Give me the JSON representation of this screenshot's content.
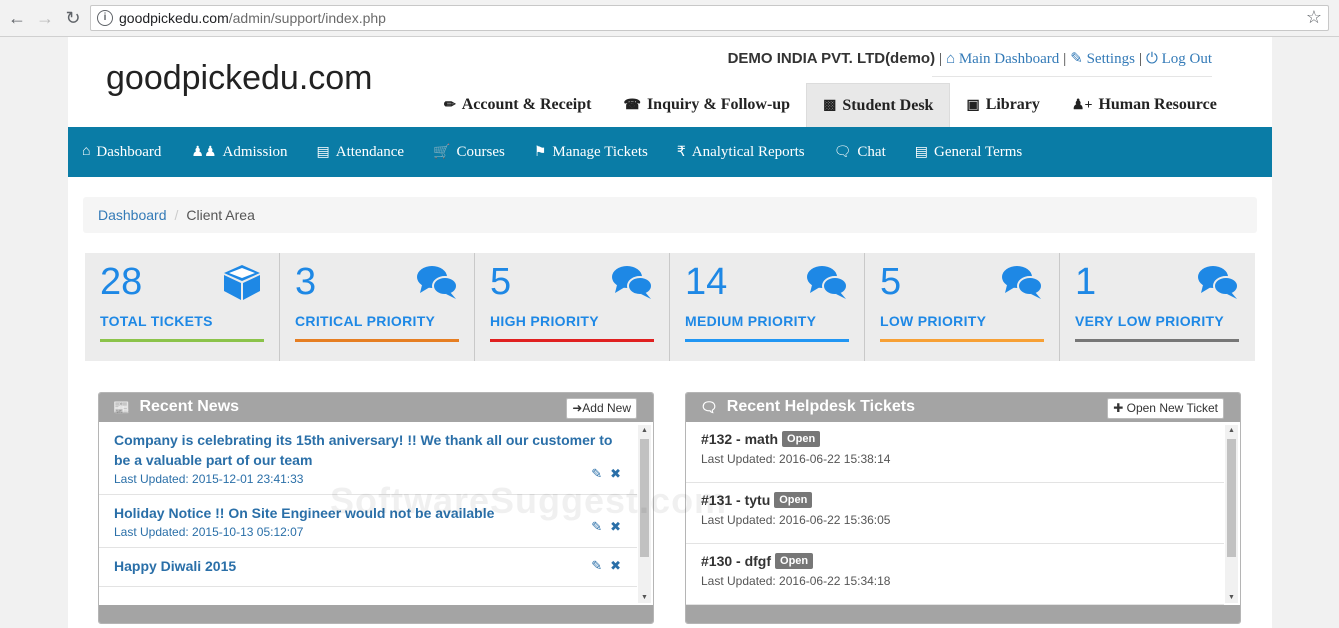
{
  "browser": {
    "url_host": "goodpickedu.com",
    "url_path": "/admin/support/index.php"
  },
  "site": {
    "logo": "goodpickedu.com",
    "company": "DEMO INDIA PVT. LTD(demo)",
    "links": {
      "main_dashboard": "Main Dashboard",
      "settings": "Settings",
      "logout": "Log Out"
    }
  },
  "main_tabs": [
    {
      "label": "Account & Receipt",
      "icon": "pencil-icon"
    },
    {
      "label": "Inquiry & Follow-up",
      "icon": "phone-icon"
    },
    {
      "label": "Student Desk",
      "icon": "desk-icon",
      "active": true
    },
    {
      "label": "Library",
      "icon": "book-icon"
    },
    {
      "label": "Human Resource",
      "icon": "user-plus-icon"
    }
  ],
  "blue_nav": [
    {
      "label": "Dashboard",
      "icon": "home-icon"
    },
    {
      "label": "Admission",
      "icon": "users-icon"
    },
    {
      "label": "Attendance",
      "icon": "list-icon"
    },
    {
      "label": "Courses",
      "icon": "cart-icon"
    },
    {
      "label": "Manage Tickets",
      "icon": "tags-icon"
    },
    {
      "label": "Analytical Reports",
      "icon": "rupee-icon"
    },
    {
      "label": "Chat",
      "icon": "comment-icon"
    },
    {
      "label": "General Terms",
      "icon": "list-icon"
    }
  ],
  "breadcrumb": {
    "home": "Dashboard",
    "current": "Client Area"
  },
  "stats": [
    {
      "value": "28",
      "label": "TOTAL TICKETS",
      "color": "#8bc34a",
      "icon": "cube-icon"
    },
    {
      "value": "3",
      "label": "CRITICAL PRIORITY",
      "color": "#e67e22",
      "icon": "comments-icon"
    },
    {
      "value": "5",
      "label": "HIGH PRIORITY",
      "color": "#e02020",
      "icon": "comments-icon"
    },
    {
      "value": "14",
      "label": "MEDIUM PRIORITY",
      "color": "#2196f3",
      "icon": "comments-icon"
    },
    {
      "value": "5",
      "label": "LOW PRIORITY",
      "color": "#f7a035",
      "icon": "comments-icon"
    },
    {
      "value": "1",
      "label": "VERY LOW PRIORITY",
      "color": "#777777",
      "icon": "comments-icon"
    }
  ],
  "news": {
    "title": "Recent News",
    "add_label": "Add New",
    "items": [
      {
        "title": "Company is celebrating its 15th aniversary! !! We thank all our customer to be a valuable part of our team",
        "date": "Last Updated: 2015-12-01 23:41:33"
      },
      {
        "title": "Holiday Notice !! On Site Engineer would not be available",
        "date": "Last Updated: 2015-10-13 05:12:07"
      },
      {
        "title": "Happy Diwali 2015",
        "date": ""
      }
    ]
  },
  "tickets": {
    "title": "Recent Helpdesk Tickets",
    "open_label": "Open New Ticket",
    "items": [
      {
        "title": "#132 - math",
        "status": "Open",
        "date": "Last Updated: 2016-06-22 15:38:14"
      },
      {
        "title": "#131 - tytu",
        "status": "Open",
        "date": "Last Updated: 2016-06-22 15:36:05"
      },
      {
        "title": "#130 - dfgf",
        "status": "Open",
        "date": "Last Updated: 2016-06-22 15:34:18"
      }
    ]
  },
  "watermark": "SoftwareSuggest.com"
}
